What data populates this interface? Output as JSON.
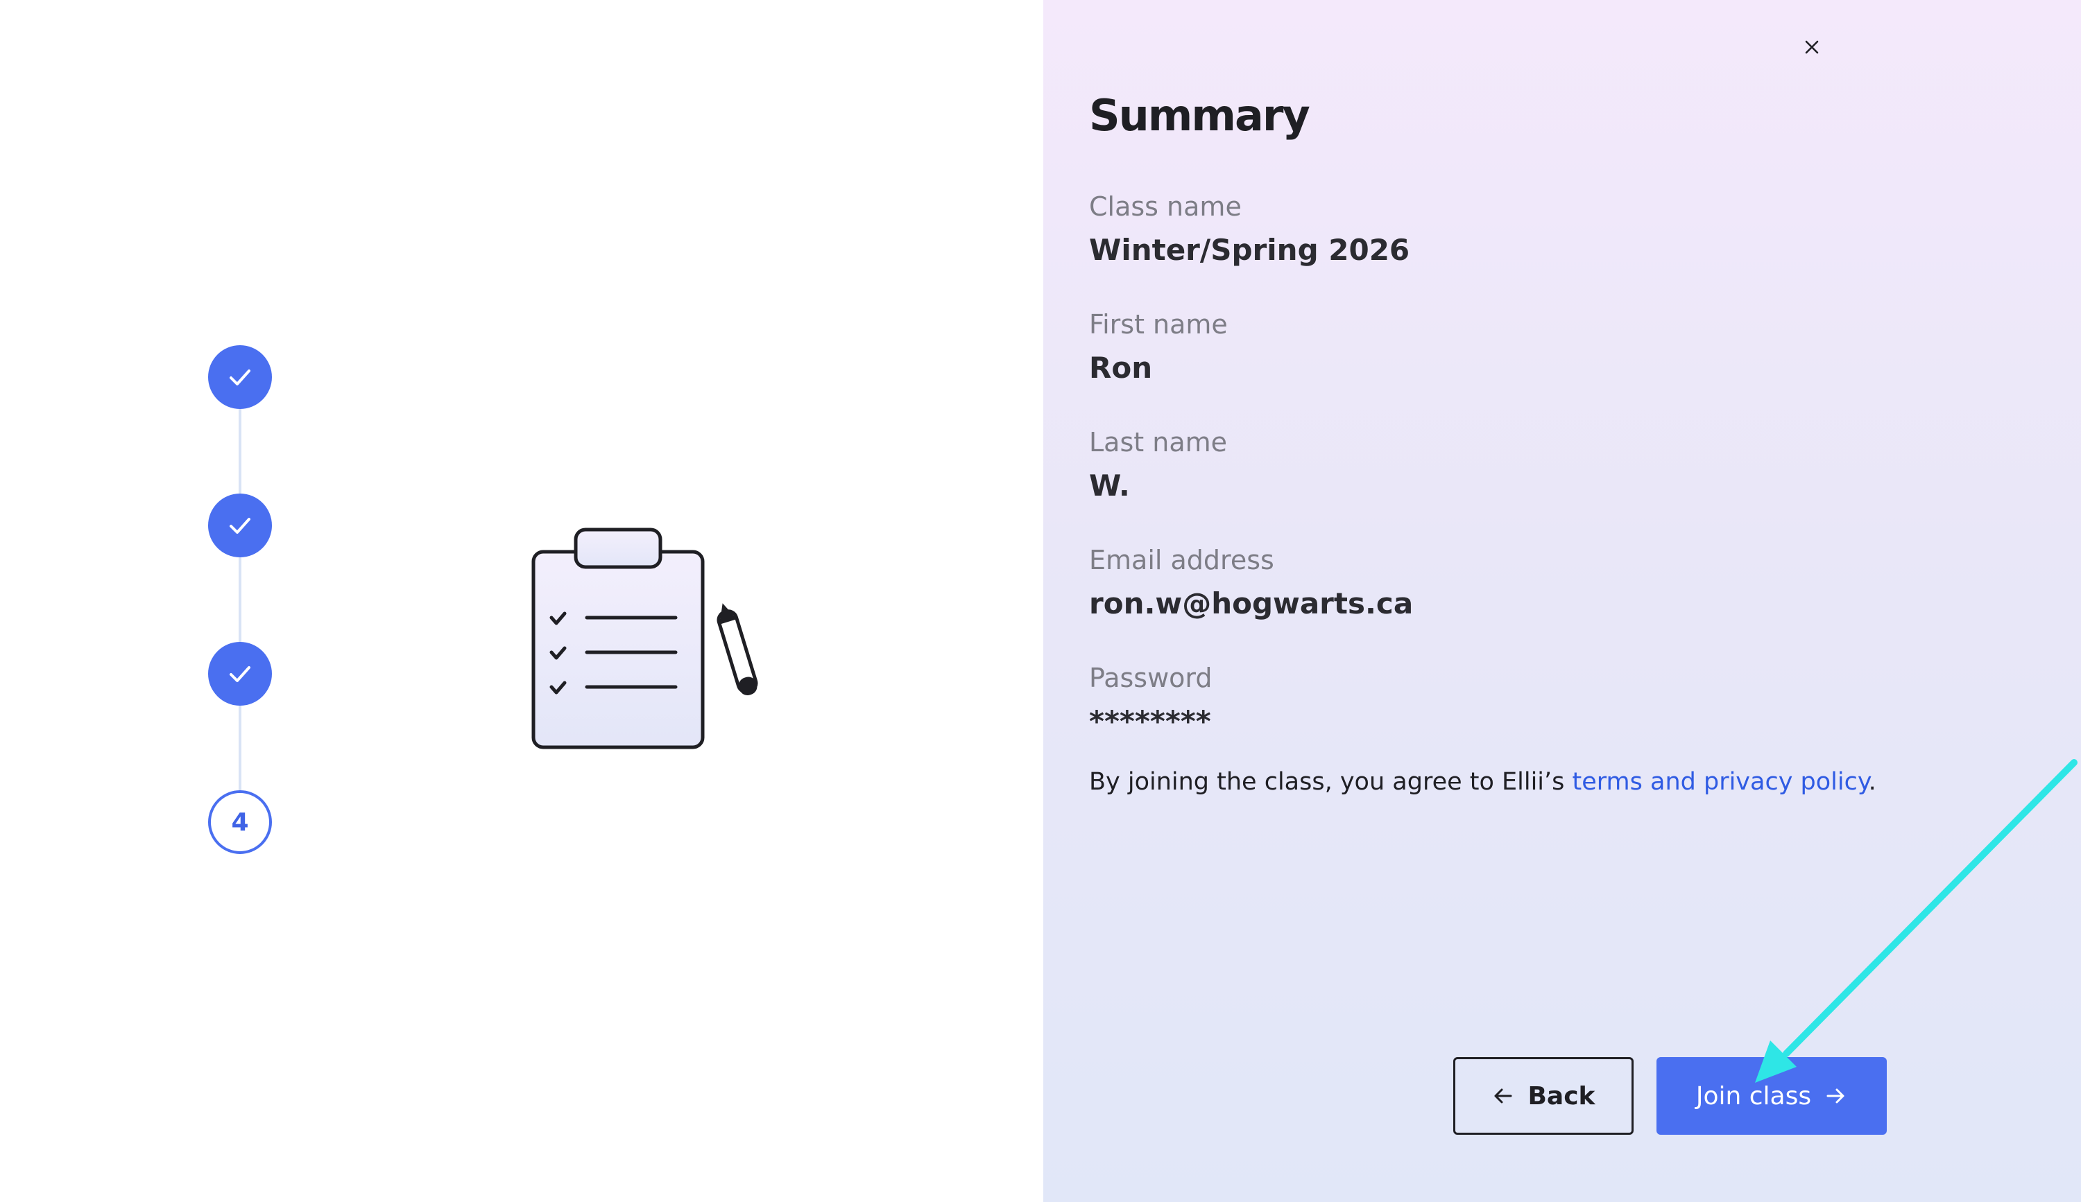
{
  "stepper": {
    "steps": [
      {
        "state": "done",
        "icon": "check-icon"
      },
      {
        "state": "done",
        "icon": "check-icon"
      },
      {
        "state": "done",
        "icon": "check-icon"
      },
      {
        "state": "current",
        "number": "4"
      }
    ]
  },
  "illustration": {
    "icon": "clipboard-checklist-icon"
  },
  "dialog": {
    "close_icon": "close-icon",
    "title": "Summary",
    "fields": {
      "class_name": {
        "label": "Class name",
        "value": "Winter/Spring 2026"
      },
      "first_name": {
        "label": "First name",
        "value": "Ron"
      },
      "last_name": {
        "label": "Last name",
        "value": "W."
      },
      "email": {
        "label": "Email address",
        "value": "ron.w@hogwarts.ca"
      },
      "password": {
        "label": "Password",
        "value": "********"
      }
    },
    "agreement": {
      "prefix": "By joining the class, you agree to Ellii’s ",
      "link": "terms and privacy policy",
      "suffix": "."
    },
    "buttons": {
      "back": {
        "label": "Back",
        "icon": "arrow-left-icon"
      },
      "join": {
        "label": "Join class",
        "icon": "arrow-right-icon"
      }
    }
  },
  "colors": {
    "accent": "#4a6ff0",
    "link": "#2f5be3",
    "annotation_arrow": "#2ee6e6"
  }
}
